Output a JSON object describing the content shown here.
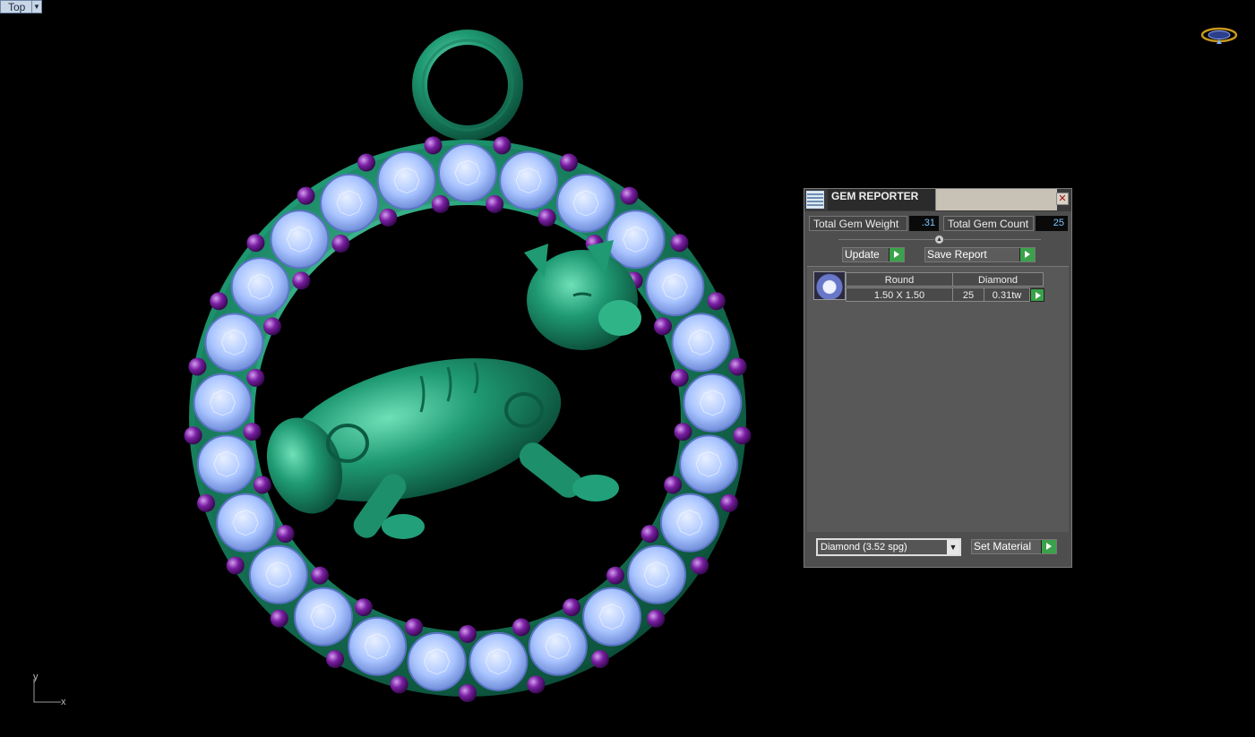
{
  "viewport": {
    "view_name": "Top",
    "axis_x": "x",
    "axis_y": "y"
  },
  "colors": {
    "metal": "#1f9a73",
    "gem": "#a9c4ff",
    "prong": "#7a1fa2",
    "background": "#000000"
  },
  "gem_reporter": {
    "title": "GEM REPORTER",
    "total_weight_label": "Total Gem Weight",
    "total_weight_value": ".31",
    "total_count_label": "Total Gem Count",
    "total_count_value": "25",
    "update_label": "Update",
    "save_report_label": "Save Report",
    "table": {
      "header_shape": "Round",
      "header_material": "Diamond",
      "size": "1.50 X 1.50",
      "count": "25",
      "weight": "0.31tw"
    },
    "material_select_value": "Diamond     (3.52 spg)",
    "set_material_label": "Set Material"
  }
}
